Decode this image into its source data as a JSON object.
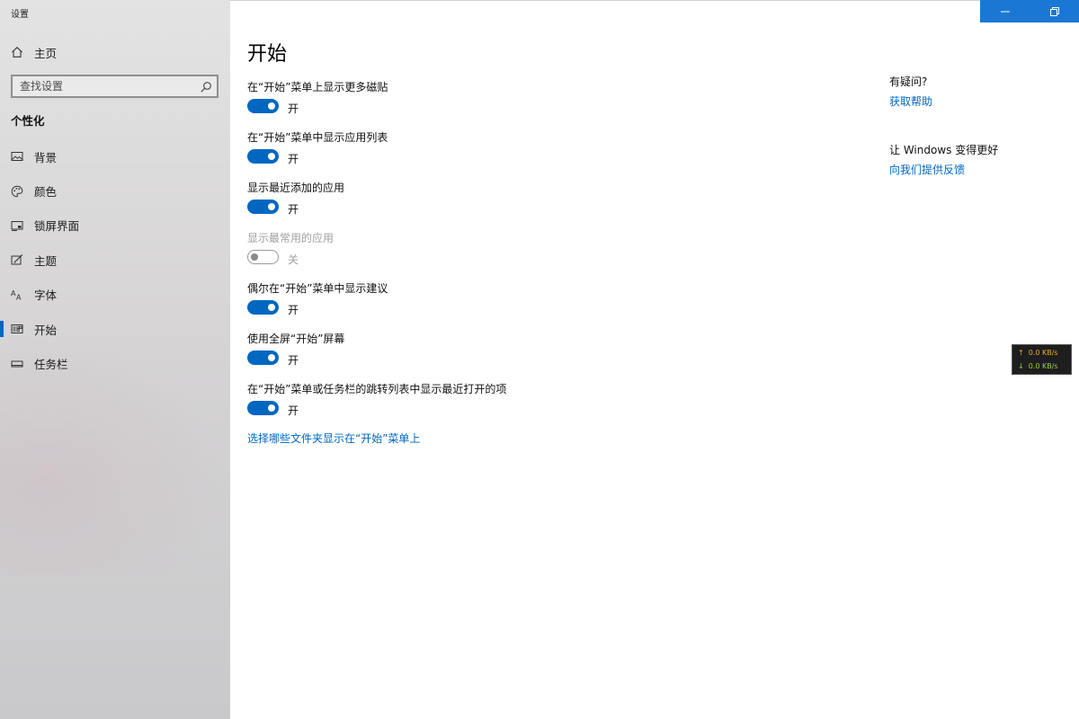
{
  "window": {
    "app_title": "设置",
    "controls": {
      "minimize_icon": "minimize-icon",
      "restore_icon": "restore-icon"
    }
  },
  "sidebar": {
    "home_label": "主页",
    "search": {
      "value": "",
      "placeholder": "查找设置"
    },
    "section_title": "个性化",
    "items": [
      {
        "label": "背景",
        "icon": "image-icon",
        "active": false
      },
      {
        "label": "颜色",
        "icon": "palette-icon",
        "active": false
      },
      {
        "label": "锁屏界面",
        "icon": "lock-screen-icon",
        "active": false
      },
      {
        "label": "主题",
        "icon": "theme-brush-icon",
        "active": false
      },
      {
        "label": "字体",
        "icon": "font-icon",
        "active": false
      },
      {
        "label": "开始",
        "icon": "start-icon",
        "active": true
      },
      {
        "label": "任务栏",
        "icon": "taskbar-icon",
        "active": false
      }
    ]
  },
  "main": {
    "title": "开始",
    "settings": [
      {
        "label": "在“开始”菜单上显示更多磁贴",
        "state": "开",
        "on": true,
        "disabled": false
      },
      {
        "label": "在“开始”菜单中显示应用列表",
        "state": "开",
        "on": true,
        "disabled": false
      },
      {
        "label": "显示最近添加的应用",
        "state": "开",
        "on": true,
        "disabled": false
      },
      {
        "label": "显示最常用的应用",
        "state": "关",
        "on": false,
        "disabled": true
      },
      {
        "label": "偶尔在“开始”菜单中显示建议",
        "state": "开",
        "on": true,
        "disabled": false
      },
      {
        "label": "使用全屏“开始”屏幕",
        "state": "开",
        "on": true,
        "disabled": false
      },
      {
        "label": "在“开始”菜单或任务栏的跳转列表中显示最近打开的项",
        "state": "开",
        "on": true,
        "disabled": false
      }
    ],
    "folders_link": "选择哪些文件夹显示在“开始”菜单上"
  },
  "help": {
    "question_heading": "有疑问?",
    "get_help_link": "获取帮助",
    "improve_heading": "让 Windows 变得更好",
    "feedback_link": "向我们提供反馈"
  },
  "net_speed": {
    "upload": "0.0 KB/s",
    "download": "0.0 KB/s",
    "upload_color": "#e7a93a",
    "download_color": "#9ccf3d"
  },
  "colors": {
    "accent": "#0067c0",
    "title_bar_buttons": "#1a78d4",
    "disabled_text": "#a0a0a0"
  }
}
